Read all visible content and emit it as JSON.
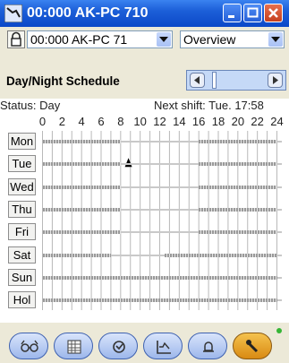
{
  "window": {
    "title": "00:000 AK-PC 710"
  },
  "toolbar": {
    "device_select_value": "00:000 AK-PC 71",
    "view_select_value": "Overview"
  },
  "header": {
    "page_title": "Day/Night Schedule"
  },
  "status": {
    "status_text": "Status: Day",
    "next_shift_text": "Next shift: Tue. 17:58"
  },
  "hours": [
    "0",
    "2",
    "4",
    "6",
    "8",
    "10",
    "12",
    "14",
    "16",
    "18",
    "20",
    "22",
    "24"
  ],
  "schedule": {
    "days": [
      "Mon",
      "Tue",
      "Wed",
      "Thu",
      "Fri",
      "Sat",
      "Sun",
      "Hol"
    ],
    "cursor": {
      "day": "Tue",
      "hour": 8.8
    },
    "segments": [
      {
        "day": "Mon",
        "intervals": [
          [
            0,
            8
          ],
          [
            16,
            24
          ]
        ]
      },
      {
        "day": "Tue",
        "intervals": [
          [
            0,
            8
          ],
          [
            16,
            24
          ]
        ]
      },
      {
        "day": "Wed",
        "intervals": [
          [
            0,
            8
          ],
          [
            16,
            24
          ]
        ]
      },
      {
        "day": "Thu",
        "intervals": [
          [
            0,
            8
          ],
          [
            16,
            24
          ]
        ]
      },
      {
        "day": "Fri",
        "intervals": [
          [
            0,
            8
          ],
          [
            16,
            24
          ]
        ]
      },
      {
        "day": "Sat",
        "intervals": [
          [
            0,
            7
          ],
          [
            12.5,
            24
          ]
        ]
      },
      {
        "day": "Sun",
        "intervals": [
          [
            0,
            24
          ]
        ]
      },
      {
        "day": "Hol",
        "intervals": [
          [
            0,
            24
          ]
        ]
      }
    ]
  },
  "nav": {
    "buttons": [
      {
        "icon": "glasses-icon"
      },
      {
        "icon": "grid-icon"
      },
      {
        "icon": "wrench-icon"
      },
      {
        "icon": "chart-icon"
      },
      {
        "icon": "bell-icon"
      },
      {
        "icon": "service-tool-icon",
        "active": true
      }
    ]
  },
  "colors": {
    "titlebar": "#0b48c8",
    "schedule_on": "#9a9a9a",
    "active_nav": "#e1a12a",
    "status_led": "#35b535"
  }
}
